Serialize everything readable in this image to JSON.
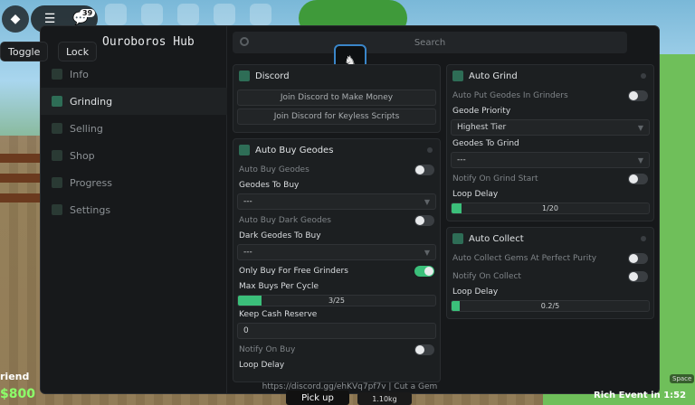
{
  "top_bar": {
    "notif_count": "39"
  },
  "chips": {
    "toggle": "Toggle",
    "lock": "Lock"
  },
  "hub": {
    "title": "Ouroboros Hub",
    "search_placeholder": "Search",
    "footer": "https://discord.gg/ehKVq7pf7v | Cut a Gem"
  },
  "nav": [
    "Info",
    "Grinding",
    "Selling",
    "Shop",
    "Progress",
    "Settings"
  ],
  "discord": {
    "title": "Discord",
    "btn1": "Join Discord to Make Money",
    "btn2": "Join Discord for Keyless Scripts"
  },
  "auto_buy": {
    "title": "Auto Buy Geodes",
    "auto_buy_geodes": "Auto Buy Geodes",
    "geodes_to_buy": "Geodes To Buy",
    "geodes_value": "---",
    "auto_buy_dark": "Auto Buy Dark Geodes",
    "dark_to_buy": "Dark Geodes To Buy",
    "dark_value": "---",
    "free_grinders": "Only Buy For Free Grinders",
    "max_buys": "Max Buys Per Cycle",
    "max_buys_value": "3/25",
    "max_buys_fraction": 0.12,
    "cash_reserve": "Keep Cash Reserve",
    "cash_reserve_value": "0",
    "notify_buy": "Notify On Buy",
    "loop_delay": "Loop Delay"
  },
  "auto_grind": {
    "title": "Auto Grind",
    "put_geodes": "Auto Put Geodes In Grinders",
    "priority": "Geode Priority",
    "priority_value": "Highest Tier",
    "to_grind": "Geodes To Grind",
    "to_grind_value": "---",
    "notify_start": "Notify On Grind Start",
    "loop_delay": "Loop Delay",
    "loop_value": "1/20",
    "loop_fraction": 0.05
  },
  "auto_collect": {
    "title": "Auto Collect",
    "collect_gems": "Auto Collect Gems At Perfect Purity",
    "notify_collect": "Notify On Collect",
    "loop_delay": "Loop Delay",
    "loop_value": "0.2/5",
    "loop_fraction": 0.04
  },
  "hud": {
    "friend": "riend",
    "cash": "$800",
    "pickup": "Pick up",
    "weight": "1.10kg",
    "event": "Rich Event in 1:52",
    "space": "Space"
  }
}
